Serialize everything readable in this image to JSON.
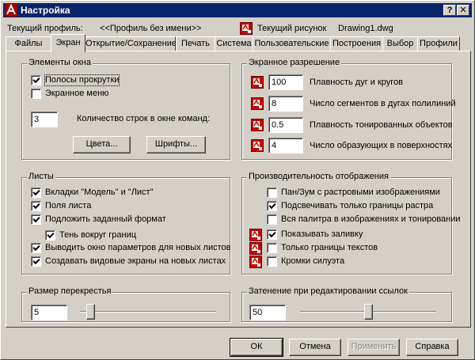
{
  "window": {
    "title": "Настройка"
  },
  "profile": {
    "label": "Текущий профиль:",
    "value": "<<Профиль без имени>>",
    "drawing_label": "Текущий рисунок",
    "drawing_value": "Drawing1.dwg"
  },
  "tabs": [
    {
      "label": "Файлы",
      "active": false
    },
    {
      "label": "Экран",
      "active": true
    },
    {
      "label": "Открытие/Сохранение",
      "active": false
    },
    {
      "label": "Печать",
      "active": false
    },
    {
      "label": "Система",
      "active": false
    },
    {
      "label": "Пользовательские",
      "active": false
    },
    {
      "label": "Построения",
      "active": false
    },
    {
      "label": "Выбор",
      "active": false
    },
    {
      "label": "Профили",
      "active": false
    }
  ],
  "window_elements": {
    "title": "Элементы окна",
    "scrollbars": {
      "label": "Полосы прокрутки",
      "checked": true
    },
    "screen_menu": {
      "label": "Экранное меню",
      "checked": false
    },
    "lines_value": "3",
    "lines_label": "Количество строк в окне команд:",
    "colors_button": "Цвета...",
    "fonts_button": "Шрифты..."
  },
  "resolution": {
    "title": "Экранное разрешение",
    "rows": [
      {
        "value": "100",
        "label": "Плавность дуг и кругов"
      },
      {
        "value": "8",
        "label": "Число сегментов в дугах полилиний"
      },
      {
        "value": "0.5",
        "label": "Плавность тонированных объектов"
      },
      {
        "value": "4",
        "label": "Число образующих в поверхностях"
      }
    ]
  },
  "layouts": {
    "title": "Листы",
    "items": [
      {
        "label": "Вкладки \"Модель\" и \"Лист\"",
        "checked": true
      },
      {
        "label": "Поля листа",
        "checked": true
      },
      {
        "label": "Подложить заданный формат",
        "checked": true
      },
      {
        "label": "Тень вокруг границ",
        "checked": true
      },
      {
        "label": "Выводить окно параметров для новых листов",
        "checked": true
      },
      {
        "label": "Создавать видовые экраны на новых листах",
        "checked": true
      }
    ]
  },
  "performance": {
    "title": "Производительность отображения",
    "items": [
      {
        "label": "Пан/Зум с растровыми изображениями",
        "checked": false,
        "icon": false
      },
      {
        "label": "Подсвечивать только границы растра",
        "checked": true,
        "icon": false
      },
      {
        "label": "Вся палитра в изображениях и тонировании",
        "checked": false,
        "icon": false
      },
      {
        "label": "Показывать заливку",
        "checked": true,
        "icon": true
      },
      {
        "label": "Только границы текстов",
        "checked": false,
        "icon": true
      },
      {
        "label": "Кромки силуэта",
        "checked": false,
        "icon": true
      }
    ]
  },
  "crosshair": {
    "title": "Размер перекрестья",
    "value": "5",
    "slider_percent": 5
  },
  "fading": {
    "title": "Затенение при редактировании ссылок",
    "value": "50",
    "slider_percent": 50
  },
  "buttons": {
    "ok": "ОК",
    "cancel": "Отмена",
    "apply": "Применить",
    "help": "Справка"
  },
  "colors": {
    "titlebar": "#0a246a",
    "face": "#d4d0c8",
    "acad_red": "#cc0000"
  },
  "icons": {
    "acad": "autocad-drawing-icon",
    "title": "autocad-app-icon",
    "help": "question-mark-icon",
    "close": "close-icon"
  }
}
